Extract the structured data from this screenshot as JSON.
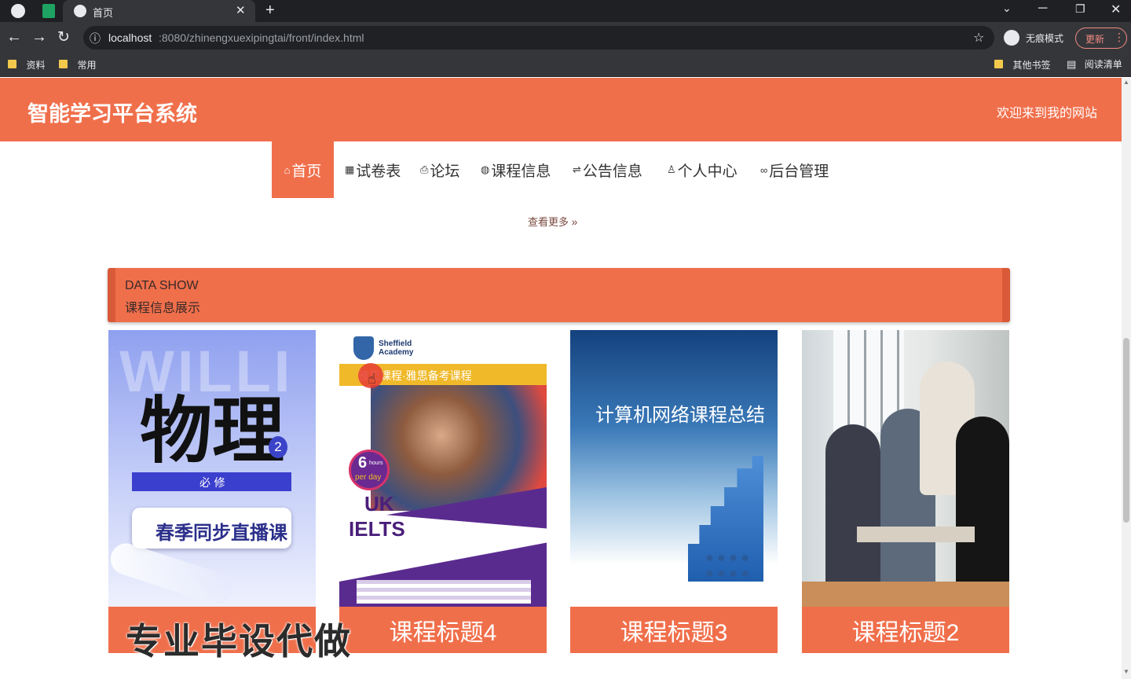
{
  "browser": {
    "tab_title": "首页",
    "url_host": "localhost",
    "url_rest": ":8080/zhinengxuexipingtai/front/index.html",
    "incognito_label": "无痕模式",
    "update_label": "更新",
    "bookmarks": [
      "资料",
      "常用"
    ],
    "other_bookmarks": "其他书签",
    "reading_list": "阅读清单"
  },
  "header": {
    "site_title": "智能学习平台系统",
    "welcome": "欢迎来到我的网站"
  },
  "nav": {
    "items": [
      {
        "label": "首页",
        "icon": "home-icon",
        "active": true
      },
      {
        "label": "试卷表",
        "icon": "grid-icon"
      },
      {
        "label": "论坛",
        "icon": "print-icon"
      },
      {
        "label": "课程信息",
        "icon": "globe-icon"
      },
      {
        "label": "公告信息",
        "icon": "sliders-icon"
      },
      {
        "label": "个人中心",
        "icon": "user-icon"
      },
      {
        "label": "后台管理",
        "icon": "link-icon"
      }
    ]
  },
  "more_link": "查看更多",
  "section": {
    "title_en": "DATA SHOW",
    "title_cn": "课程信息展示"
  },
  "cards": [
    {
      "caption": "",
      "image": {
        "big_text": "物理",
        "badge": "2",
        "tag": "必 修",
        "sub": "春季同步直播课",
        "bg_word": "WILLI"
      }
    },
    {
      "caption": "课程标题4",
      "image": {
        "brand": "Sheffield Academy",
        "banner": "雅思课程·雅思备考课程",
        "hours": "6",
        "hours_unit": "hours",
        "per_day": "per day",
        "uk": "UK",
        "ielts": "IELTS"
      }
    },
    {
      "caption": "课程标题3",
      "image": {
        "title": "计算机网络课程总结"
      }
    },
    {
      "caption": "课程标题2",
      "image": {}
    }
  ],
  "watermark": "专业毕设代做",
  "colors": {
    "accent": "#f06f4b",
    "accent_dark": "#d85a38"
  }
}
